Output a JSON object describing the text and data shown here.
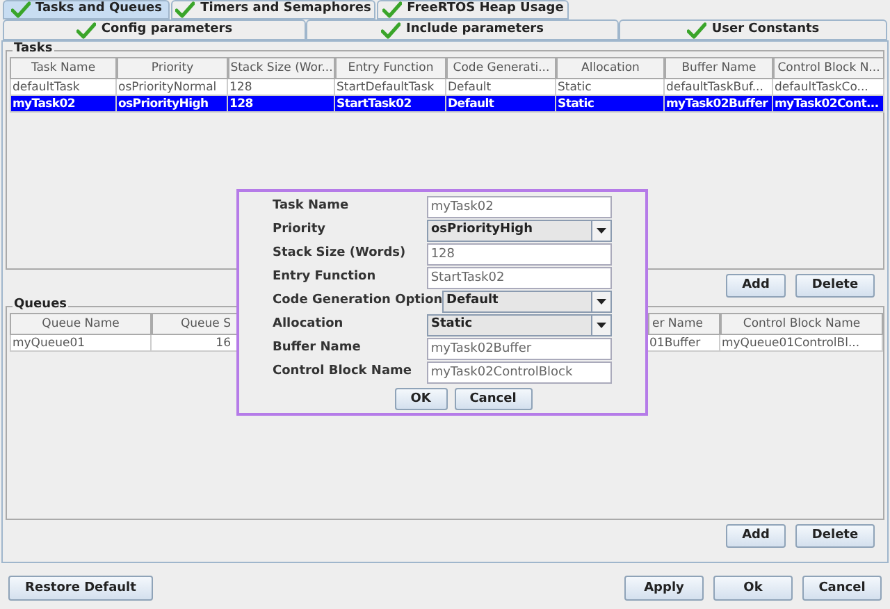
{
  "tabs_row1": [
    {
      "label": "Tasks and Queues",
      "selected": true
    },
    {
      "label": "Timers and Semaphores",
      "selected": false
    },
    {
      "label": "FreeRTOS Heap Usage",
      "selected": false
    }
  ],
  "tabs_row2": [
    {
      "label": "Config parameters",
      "selected": false
    },
    {
      "label": "Include parameters",
      "selected": false
    },
    {
      "label": "User Constants",
      "selected": false
    }
  ],
  "tasks": {
    "title": "Tasks",
    "columns": [
      "Task Name",
      "Priority",
      "Stack Size (Wor...",
      "Entry Function",
      "Code Generati...",
      "Allocation",
      "Buffer Name",
      "Control Block N..."
    ],
    "rows": [
      {
        "selected": false,
        "cells": [
          "defaultTask",
          "osPriorityNormal",
          "128",
          "StartDefaultTask",
          "Default",
          "Static",
          "defaultTaskBuf...",
          "defaultTaskCo..."
        ]
      },
      {
        "selected": true,
        "cells": [
          "myTask02",
          "osPriorityHigh",
          "128",
          "StartTask02",
          "Default",
          "Static",
          "myTask02Buffer",
          "myTask02Cont..."
        ]
      }
    ],
    "buttons": [
      "Add",
      "Delete"
    ]
  },
  "queues": {
    "title": "Queues",
    "columns": [
      "Queue Name",
      "Queue S",
      "er Name",
      "Control Block Name"
    ],
    "rows": [
      {
        "selected": false,
        "cells": [
          "myQueue01",
          "16",
          "01Buffer",
          "myQueue01ControlBl..."
        ]
      }
    ],
    "buttons": [
      "Add",
      "Delete"
    ]
  },
  "dialog": {
    "fields": [
      {
        "label": "Task Name",
        "kind": "text",
        "value": "myTask02"
      },
      {
        "label": "Priority",
        "kind": "dropdown",
        "value": "osPriorityHigh"
      },
      {
        "label": "Stack Size (Words)",
        "kind": "text",
        "value": "128"
      },
      {
        "label": "Entry Function",
        "kind": "text",
        "value": "StartTask02"
      },
      {
        "label": "Code Generation Option",
        "kind": "dropdown",
        "value": "Default"
      },
      {
        "label": "Allocation",
        "kind": "dropdown",
        "value": "Static"
      },
      {
        "label": "Buffer Name",
        "kind": "text",
        "value": "myTask02Buffer"
      },
      {
        "label": "Control Block Name",
        "kind": "text",
        "value": "myTask02ControlBlock"
      }
    ],
    "buttons": [
      "OK",
      "Cancel"
    ]
  },
  "footer": {
    "left_button": "Restore Default",
    "right_buttons": [
      "Apply",
      "Ok",
      "Cancel"
    ]
  }
}
